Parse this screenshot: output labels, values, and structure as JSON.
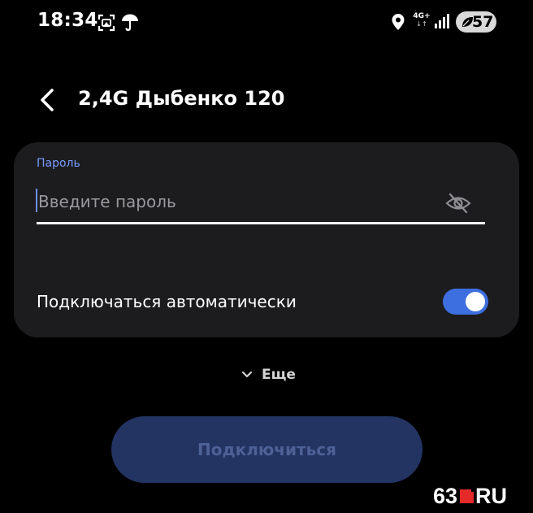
{
  "status_bar": {
    "time": "18:34",
    "network_type": "4G+",
    "network_arrows": "↓↑",
    "battery_level": "57",
    "icons": [
      "screenshot-icon",
      "umbrella-icon",
      "location-icon",
      "signal-icon",
      "battery-saver-leaf-icon"
    ]
  },
  "header": {
    "back_icon": "chevron-left-icon",
    "title": "2,4G Дыбенко 120"
  },
  "form": {
    "password_label": "Пароль",
    "password_value": "",
    "password_placeholder": "Введите пароль",
    "visibility_icon": "eye-off-icon",
    "auto_connect_label": "Подключаться автоматически",
    "auto_connect_enabled": true
  },
  "more": {
    "icon": "chevron-down-icon",
    "label": "Еще"
  },
  "connect_button": {
    "label": "Подключиться",
    "enabled": false
  },
  "watermark": {
    "left_text": "63",
    "right_text": "RU"
  },
  "colors": {
    "background": "#000000",
    "card": "#1c1c1e",
    "accent": "#3e6fe0",
    "label_blue": "#7a9cff",
    "button_disabled_bg": "#233463",
    "button_disabled_text": "#4e6196",
    "watermark_red": "#e52a2a"
  }
}
